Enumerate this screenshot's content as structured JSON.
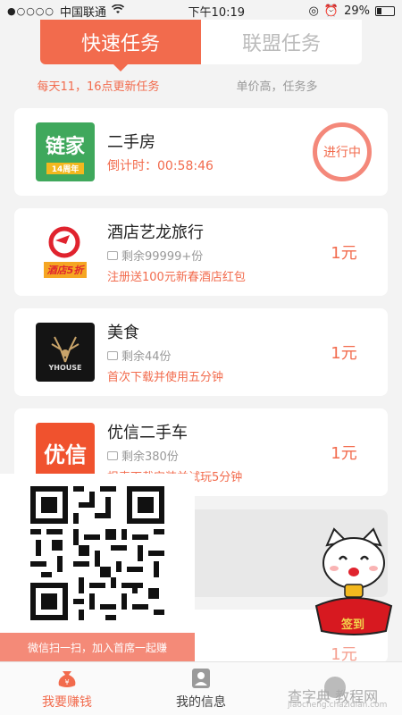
{
  "status": {
    "carrier": "中国联通",
    "time": "下午10:19",
    "battery": "29%"
  },
  "tabs": {
    "active": "快速任务",
    "inactive": "联盟任务"
  },
  "subtitles": {
    "left": "每天11，16点更新任务",
    "right": "单价高，任务多"
  },
  "tasks": [
    {
      "name": "二手房",
      "countdown_label": "倒计时：",
      "countdown": "00:58:46",
      "status": "进行中",
      "logo_text": "链家",
      "logo_sub": "14周年"
    },
    {
      "name": "酒店艺龙旅行",
      "remaining": "剩余99999+份",
      "desc": "注册送100元新春酒店红包",
      "price": "1元",
      "logo_text": "酒店5折"
    },
    {
      "name": "美食",
      "remaining": "剩余44份",
      "desc": "首次下载并使用五分钟",
      "price": "1元",
      "logo_text": "YHOUSE"
    },
    {
      "name": "优信二手车",
      "remaining": "剩余380份",
      "desc": "根表下载安装并试玩5分钟",
      "price": "1元",
      "logo_text": "优信"
    }
  ],
  "hidden_price": "1元",
  "qr_caption": "微信扫一扫，加入首席一起赚",
  "checkin_label": "签到",
  "nav": [
    {
      "label": "我要赚钱"
    },
    {
      "label": "我的信息"
    }
  ],
  "watermark": {
    "main": "查字典 教程网",
    "sub": "jiaocheng.chazidian.com"
  },
  "colors": {
    "accent": "#f26b4d"
  }
}
